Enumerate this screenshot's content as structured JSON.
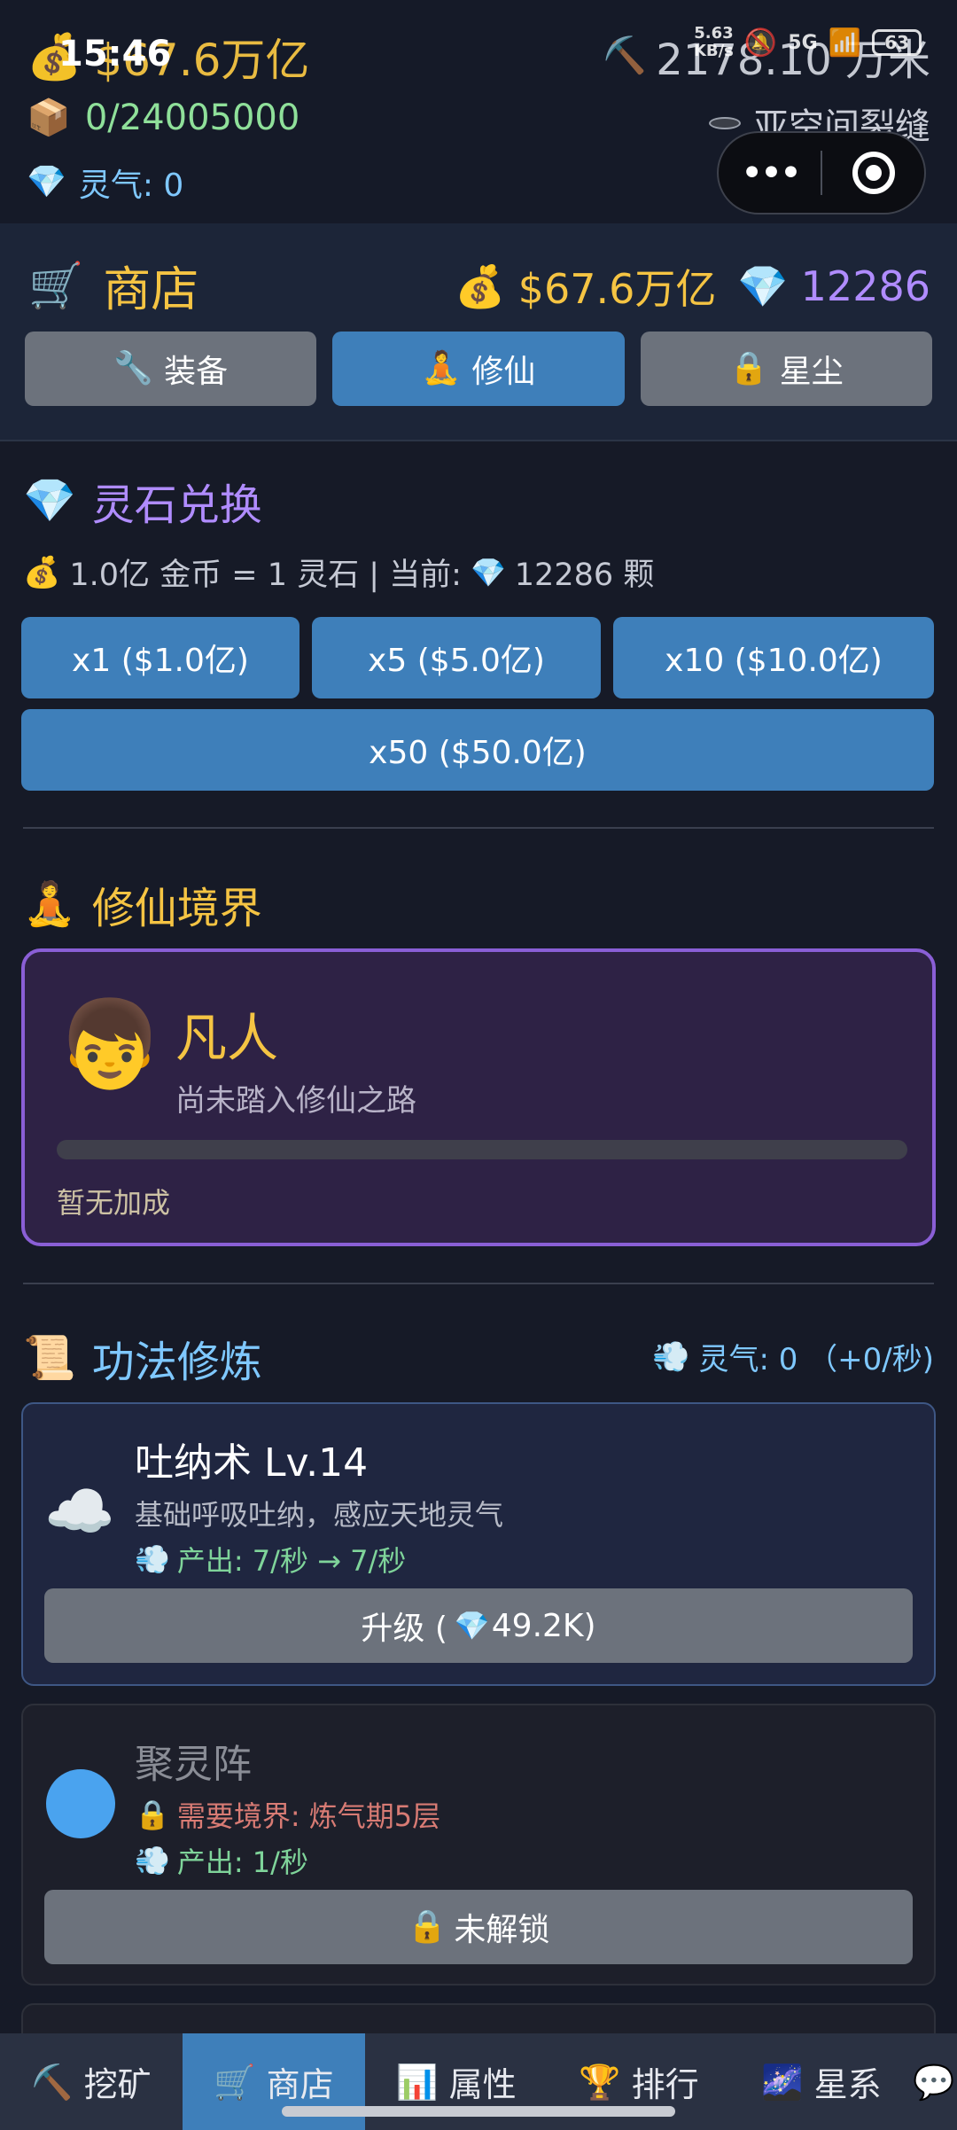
{
  "status": {
    "time": "15:46",
    "speed_top": "5.63",
    "speed_bottom": "KB/s",
    "network": "5G",
    "battery": "63"
  },
  "header": {
    "money": "$67.6万亿",
    "distance": "2178.10 万米",
    "ore": "0/24005000",
    "location": "亚空间裂缝",
    "spirit": "灵气: 0",
    "icons": {
      "money": "money-bag-icon",
      "ore": "box-icon",
      "spirit": "gem-icon",
      "location": "portal-icon",
      "distance": "pickaxe-icon"
    }
  },
  "shop": {
    "title": "商店",
    "gold": "$67.6万亿",
    "gems": "12286",
    "tabs": [
      {
        "label": "装备",
        "icon": "wrench-icon"
      },
      {
        "label": "修仙",
        "icon": "meditation-icon"
      },
      {
        "label": "星尘",
        "icon": "lock-icon"
      }
    ]
  },
  "exchange": {
    "title": "灵石兑换",
    "desc_rate": "1.0亿 金币 = 1 灵石 | 当前:",
    "desc_count": "12286 颗",
    "buttons": [
      "x1 ($1.0亿)",
      "x5 ($5.0亿)",
      "x10 ($10.0亿)",
      "x50 ($50.0亿)"
    ]
  },
  "realm": {
    "title": "修仙境界",
    "name": "凡人",
    "desc": "尚未踏入修仙之路",
    "progress": 0,
    "bonus": "暂无加成"
  },
  "technique": {
    "title": "功法修炼",
    "spirit_status": "灵气: 0 （+0/秒)",
    "items": [
      {
        "name": "吐纳术 Lv.14",
        "desc": "基础呼吸吐纳，感应天地灵气",
        "output": "产出: 7/秒 → 7/秒",
        "button": "升级 (",
        "button_cost": "49.2K)"
      },
      {
        "name": "聚灵阵",
        "requirement": "需要境界: 炼气期5层",
        "output": "产出: 1/秒",
        "button": "未解锁"
      }
    ]
  },
  "bottom_nav": [
    {
      "label": "挖矿",
      "icon": "pickaxe-icon"
    },
    {
      "label": "商店",
      "icon": "cart-icon"
    },
    {
      "label": "属性",
      "icon": "chart-icon"
    },
    {
      "label": "排行",
      "icon": "trophy-icon"
    },
    {
      "label": "星系",
      "icon": "galaxy-icon"
    }
  ],
  "colors": {
    "accent_blue": "#3e7fba",
    "gold": "#f5c443",
    "purple": "#b08cff",
    "sky": "#7fc8ff",
    "green": "#8fe09a"
  }
}
